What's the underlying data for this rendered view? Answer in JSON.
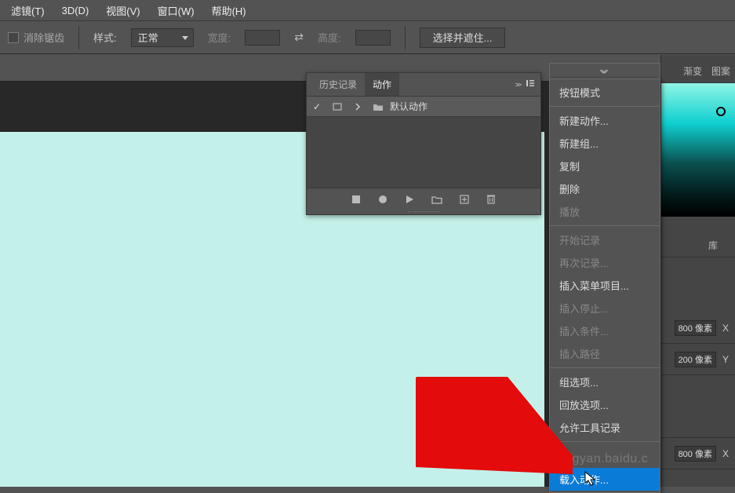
{
  "menu": {
    "filter": "滤镜(T)",
    "threed": "3D(D)",
    "view": "视图(V)",
    "window": "窗口(W)",
    "help": "帮助(H)"
  },
  "optbar": {
    "antialias": "消除锯齿",
    "style": "样式:",
    "style_value": "正常",
    "width": "宽度:",
    "height": "高度:",
    "select_button": "选择并遮住..."
  },
  "actions_panel": {
    "tab_history": "历史记录",
    "tab_actions": "动作",
    "default_action": "默认动作",
    "expand_glyph": ">>"
  },
  "ctx": {
    "button_mode": "按钮模式",
    "new_action": "新建动作...",
    "new_group": "新建组...",
    "duplicate": "复制",
    "delete": "删除",
    "play": "播放",
    "start_record": "开始记录",
    "record_again": "再次记录...",
    "insert_menu": "插入菜单项目...",
    "insert_stop": "插入停止...",
    "insert_cond": "插入条件...",
    "insert_path": "插入路径",
    "group_options": "组选项...",
    "playback_options": "回放选项...",
    "allow_tool_record": "允许工具记录",
    "load_action": "载入动作..."
  },
  "right": {
    "tab_gradient": "渐变",
    "tab_pattern": "图案",
    "tab_lib": "库",
    "info": [
      {
        "val": "800 像素",
        "axis": "X"
      },
      {
        "val": "200 像素",
        "axis": "Y"
      },
      {
        "val": "800 像素",
        "axis": "X"
      }
    ]
  },
  "watermark": "jingyan.baidu.c"
}
